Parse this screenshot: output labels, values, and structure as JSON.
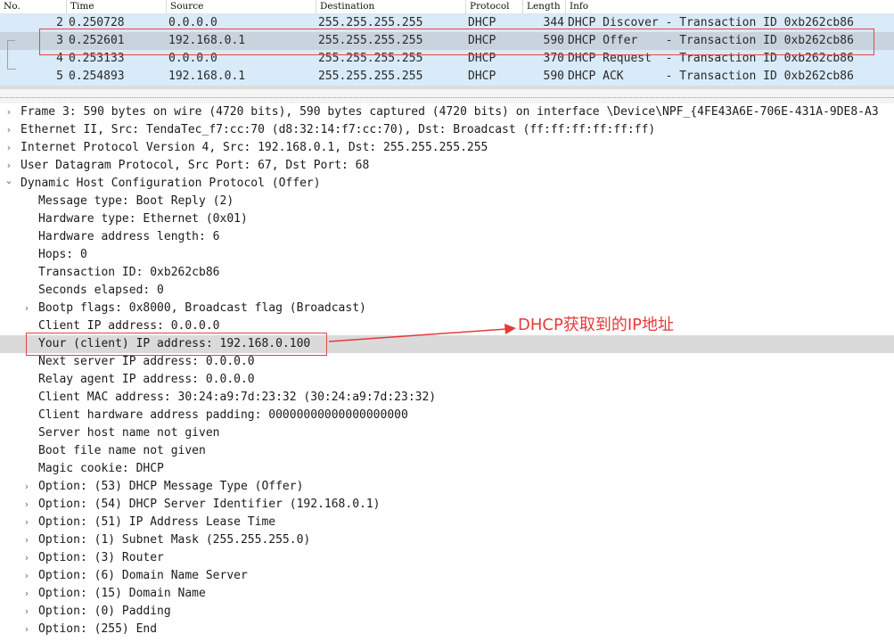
{
  "packet_list": {
    "columns": [
      "No.",
      "Time",
      "Source",
      "Destination",
      "Protocol",
      "Length",
      "Info"
    ],
    "rows": [
      {
        "no": "2",
        "time": "0.250728",
        "src": "0.0.0.0",
        "dst": "255.255.255.255",
        "proto": "DHCP",
        "len": "344",
        "info": "DHCP Discover - Transaction ID 0xb262cb86",
        "selected": false
      },
      {
        "no": "3",
        "time": "0.252601",
        "src": "192.168.0.1",
        "dst": "255.255.255.255",
        "proto": "DHCP",
        "len": "590",
        "info": "DHCP Offer    - Transaction ID 0xb262cb86",
        "selected": true
      },
      {
        "no": "4",
        "time": "0.253133",
        "src": "0.0.0.0",
        "dst": "255.255.255.255",
        "proto": "DHCP",
        "len": "370",
        "info": "DHCP Request  - Transaction ID 0xb262cb86",
        "selected": false
      },
      {
        "no": "5",
        "time": "0.254893",
        "src": "192.168.0.1",
        "dst": "255.255.255.255",
        "proto": "DHCP",
        "len": "590",
        "info": "DHCP ACK      - Transaction ID 0xb262cb86",
        "selected": false
      }
    ]
  },
  "details": {
    "rows": [
      {
        "text": "Frame 3: 590 bytes on wire (4720 bits), 590 bytes captured (4720 bits) on interface \\Device\\NPF_{4FE43A6E-706E-431A-9DE8-A3",
        "expander": ">"
      },
      {
        "text": "Ethernet II, Src: TendaTec_f7:cc:70 (d8:32:14:f7:cc:70), Dst: Broadcast (ff:ff:ff:ff:ff:ff)",
        "expander": ">"
      },
      {
        "text": "Internet Protocol Version 4, Src: 192.168.0.1, Dst: 255.255.255.255",
        "expander": ">"
      },
      {
        "text": "User Datagram Protocol, Src Port: 67, Dst Port: 68",
        "expander": ">"
      },
      {
        "text": "Dynamic Host Configuration Protocol (Offer)",
        "expander": "v"
      },
      {
        "text": "Message type: Boot Reply (2)",
        "expander": ""
      },
      {
        "text": "Hardware type: Ethernet (0x01)",
        "expander": ""
      },
      {
        "text": "Hardware address length: 6",
        "expander": ""
      },
      {
        "text": "Hops: 0",
        "expander": ""
      },
      {
        "text": "Transaction ID: 0xb262cb86",
        "expander": ""
      },
      {
        "text": "Seconds elapsed: 0",
        "expander": ""
      },
      {
        "text": "Bootp flags: 0x8000, Broadcast flag (Broadcast)",
        "expander": ">"
      },
      {
        "text": "Client IP address: 0.0.0.0",
        "expander": ""
      },
      {
        "text": "Your (client) IP address: 192.168.0.100",
        "expander": "",
        "highlight": true
      },
      {
        "text": "Next server IP address: 0.0.0.0",
        "expander": ""
      },
      {
        "text": "Relay agent IP address: 0.0.0.0",
        "expander": ""
      },
      {
        "text": "Client MAC address: 30:24:a9:7d:23:32 (30:24:a9:7d:23:32)",
        "expander": ""
      },
      {
        "text": "Client hardware address padding: 00000000000000000000",
        "expander": ""
      },
      {
        "text": "Server host name not given",
        "expander": ""
      },
      {
        "text": "Boot file name not given",
        "expander": ""
      },
      {
        "text": "Magic cookie: DHCP",
        "expander": ""
      },
      {
        "text": "Option: (53) DHCP Message Type (Offer)",
        "expander": ">"
      },
      {
        "text": "Option: (54) DHCP Server Identifier (192.168.0.1)",
        "expander": ">"
      },
      {
        "text": "Option: (51) IP Address Lease Time",
        "expander": ">"
      },
      {
        "text": "Option: (1) Subnet Mask (255.255.255.0)",
        "expander": ">"
      },
      {
        "text": "Option: (3) Router",
        "expander": ">"
      },
      {
        "text": "Option: (6) Domain Name Server",
        "expander": ">"
      },
      {
        "text": "Option: (15) Domain Name",
        "expander": ">"
      },
      {
        "text": "Option: (0) Padding",
        "expander": ">"
      },
      {
        "text": "Option: (255) End",
        "expander": ">"
      }
    ]
  },
  "annotation": {
    "label": "DHCP获取到的IP地址",
    "color": "#e53a3a"
  }
}
